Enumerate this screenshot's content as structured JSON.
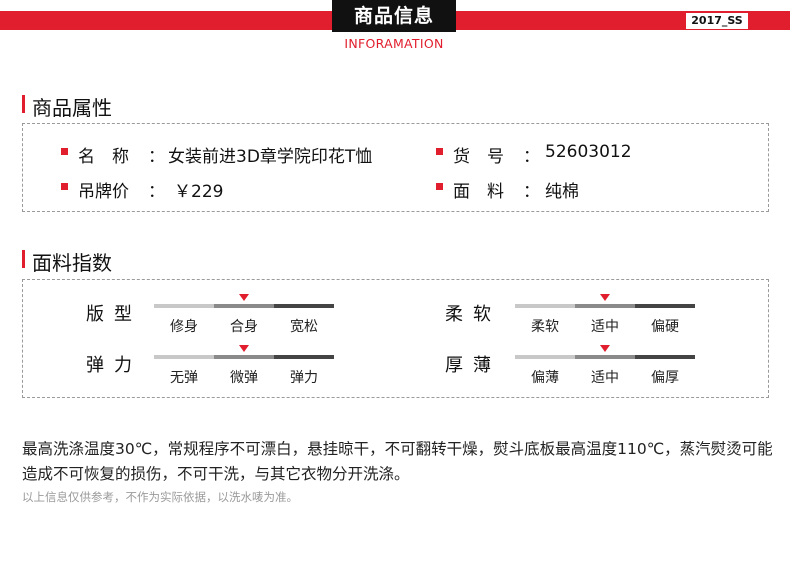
{
  "header": {
    "title": "商品信息",
    "subtitle": "INFORAMATION",
    "season": "2017_SS",
    "accent_color": "#e11e2e"
  },
  "attributes_section": {
    "heading": "商品属性",
    "items": [
      {
        "label": "名　称",
        "value": "女装前进3D章学院印花T恤"
      },
      {
        "label": "货　号",
        "value": "52603012"
      },
      {
        "label": "吊牌价",
        "value": "￥229"
      },
      {
        "label": "面　料",
        "value": "纯棉"
      }
    ],
    "colon": "："
  },
  "fabric_section": {
    "heading": "面料指数",
    "indices": [
      {
        "label": "版型",
        "options": [
          "修身",
          "合身",
          "宽松"
        ],
        "selected_index": 1
      },
      {
        "label": "柔软",
        "options": [
          "柔软",
          "适中",
          "偏硬"
        ],
        "selected_index": 1
      },
      {
        "label": "弹力",
        "options": [
          "无弹",
          "微弹",
          "弹力"
        ],
        "selected_index": 1
      },
      {
        "label": "厚薄",
        "options": [
          "偏薄",
          "适中",
          "偏厚"
        ],
        "selected_index": 1
      }
    ]
  },
  "care_text": "最高洗涤温度30℃，常规程序不可漂白，悬挂晾干，不可翻转干燥，熨斗底板最高温度110℃，蒸汽熨烫可能造成不可恢复的损伤，不可干洗，与其它衣物分开洗涤。",
  "disclaimer": "以上信息仅供参考，不作为实际依据，以洗水唛为准。"
}
